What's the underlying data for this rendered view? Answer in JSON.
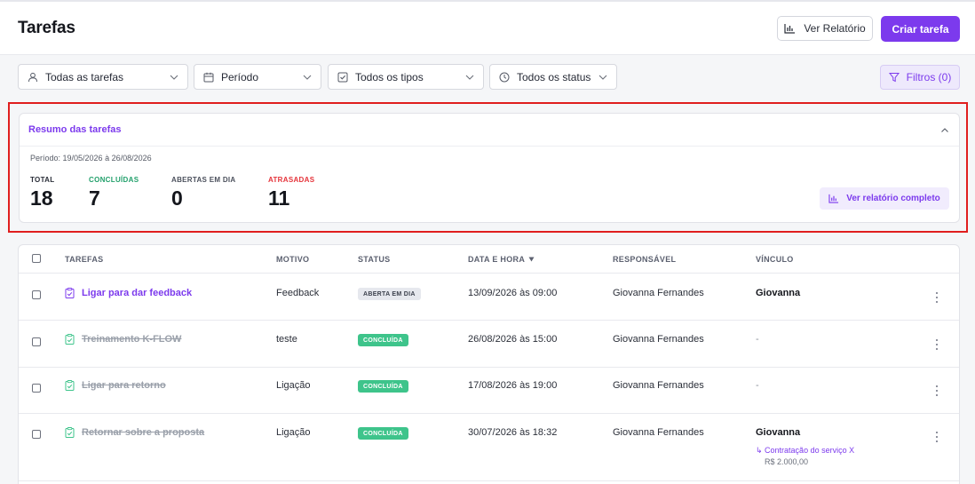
{
  "page": {
    "title": "Tarefas",
    "report_button": "Ver Relatório",
    "create_button": "Criar tarefa"
  },
  "filters": {
    "assignee": "Todas as tarefas",
    "period": "Período",
    "type": "Todos os tipos",
    "status": "Todos os status",
    "filters_button": "Filtros (0)"
  },
  "summary": {
    "title": "Resumo das tarefas",
    "period": "Período: 19/05/2026 à 26/08/2026",
    "stats": [
      {
        "label": "TOTAL",
        "value": "18",
        "color": "#2a2e38"
      },
      {
        "label": "CONCLUÍDAS",
        "value": "7",
        "color": "#22a06b"
      },
      {
        "label": "ABERTAS EM DIA",
        "value": "0",
        "color": "#4b505c"
      },
      {
        "label": "ATRASADAS",
        "value": "11",
        "color": "#e5333a"
      }
    ],
    "full_report_button": "Ver relatório completo"
  },
  "table": {
    "headers": {
      "tasks": "TAREFAS",
      "reason": "MOTIVO",
      "status": "STATUS",
      "datetime": "DATA E HORA",
      "responsible": "RESPONSÁVEL",
      "link": "VÍNCULO"
    },
    "rows": [
      {
        "task": "Ligar para dar feedback",
        "reason": "Feedback",
        "status": "ABERTA EM DIA",
        "datetime": "13/09/2026 às 09:00",
        "responsible": "Giovanna Fernandes",
        "link": "Giovanna"
      },
      {
        "task": "Treinamento K-FLOW",
        "reason": "teste",
        "status": "CONCLUÍDA",
        "datetime": "26/08/2026 às 15:00",
        "responsible": "Giovanna Fernandes",
        "link": "-"
      },
      {
        "task": "Ligar para retorno",
        "reason": "Ligação",
        "status": "CONCLUÍDA",
        "datetime": "17/08/2026 às 19:00",
        "responsible": "Giovanna Fernandes",
        "link": "-"
      },
      {
        "task": "Retornar sobre a proposta",
        "reason": "Ligação",
        "status": "CONCLUÍDA",
        "datetime": "30/07/2026 às 18:32",
        "responsible": "Giovanna Fernandes",
        "link": "Giovanna",
        "link_detail": "↳ Contratação do serviço X",
        "link_value": "R$ 2.000,00"
      }
    ]
  },
  "colors": {
    "accent": "#7c3aed",
    "done": "#3ec48b",
    "late": "#e5333a",
    "highlight": "#e01e1e"
  }
}
